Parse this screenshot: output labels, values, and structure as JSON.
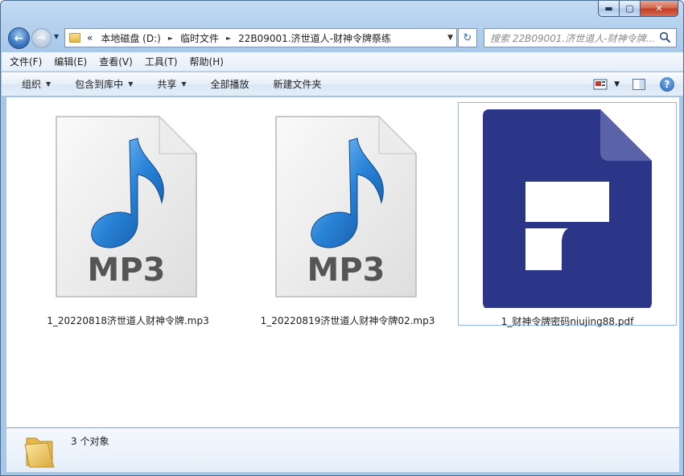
{
  "window": {
    "caption": {
      "minimize_glyph": "▬",
      "maximize_glyph": "▢",
      "close_glyph": "✕"
    }
  },
  "nav": {
    "back_glyph": "←",
    "forward_glyph": "→",
    "history_glyph": "▼",
    "refresh_glyph": "↻"
  },
  "address": {
    "overflow": "«",
    "segments": [
      "本地磁盘 (D:)",
      "临时文件",
      "22B09001.济世道人-财神令牌祭练"
    ],
    "separator": "►",
    "dropdown_glyph": "▼"
  },
  "search": {
    "placeholder": "搜索 22B09001.济世道人-财神令牌..."
  },
  "menu": {
    "items": [
      "文件(F)",
      "编辑(E)",
      "查看(V)",
      "工具(T)",
      "帮助(H)"
    ]
  },
  "commands": {
    "organize": "组织",
    "include_library": "包含到库中",
    "share": "共享",
    "play_all": "全部播放",
    "new_folder": "新建文件夹",
    "caret": "▼",
    "help_glyph": "?"
  },
  "files": [
    {
      "name": "1_20220818济世道人财神令牌.mp3",
      "type_label": "MP3",
      "kind": "mp3",
      "selected": false
    },
    {
      "name": "1_20220819济世道人财神令牌02.mp3",
      "type_label": "MP3",
      "kind": "mp3",
      "selected": false
    },
    {
      "name": "1_财神令牌密码niujing88.pdf",
      "type_label": "",
      "kind": "pdf",
      "selected": true
    }
  ],
  "status": {
    "count_text": "3 个对象"
  },
  "colors": {
    "pdf_blue": "#2c3688",
    "pdf_fold": "#5a62a8",
    "note_blue": "#2a84d8",
    "selection_border": "#8fb8e4"
  }
}
